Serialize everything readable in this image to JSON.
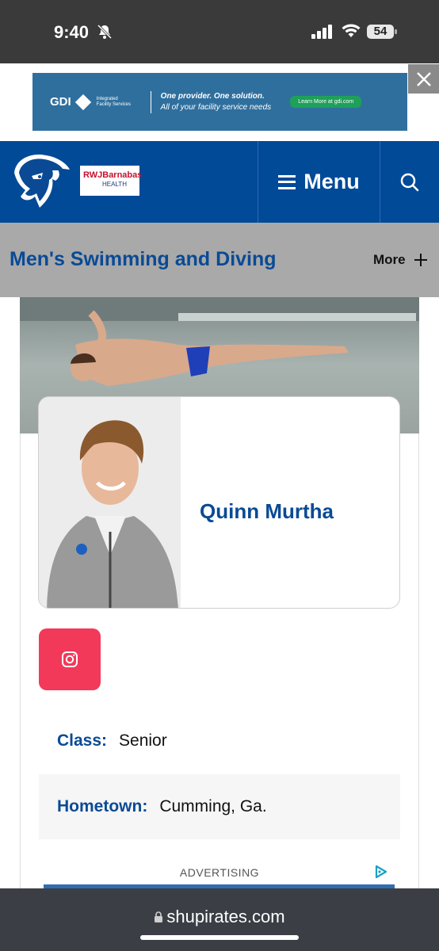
{
  "status_bar": {
    "time": "9:40",
    "battery": "54"
  },
  "top_ad": {
    "brand": "GDI",
    "brand_sub": "Integrated Facility Services",
    "tagline_1": "One provider. One solution.",
    "tagline_2": "All of your facility service needs",
    "cta": "Learn More at gdi.com"
  },
  "header": {
    "sponsor_line_1": "RWJBarnabas",
    "sponsor_line_2": "HEALTH",
    "menu_label": "Menu"
  },
  "subnav": {
    "sport_title": "Men's Swimming and Diving",
    "more_label": "More"
  },
  "player": {
    "name": "Quinn Murtha",
    "class_label": "Class:",
    "class_value": "Senior",
    "hometown_label": "Hometown:",
    "hometown_value": "Cumming, Ga."
  },
  "advertising_label": "ADVERTISING",
  "browser": {
    "url": "shupirates.com"
  },
  "colors": {
    "brand_blue": "#004a98",
    "title_blue": "#0a4a95",
    "instagram": "#f2395a"
  }
}
